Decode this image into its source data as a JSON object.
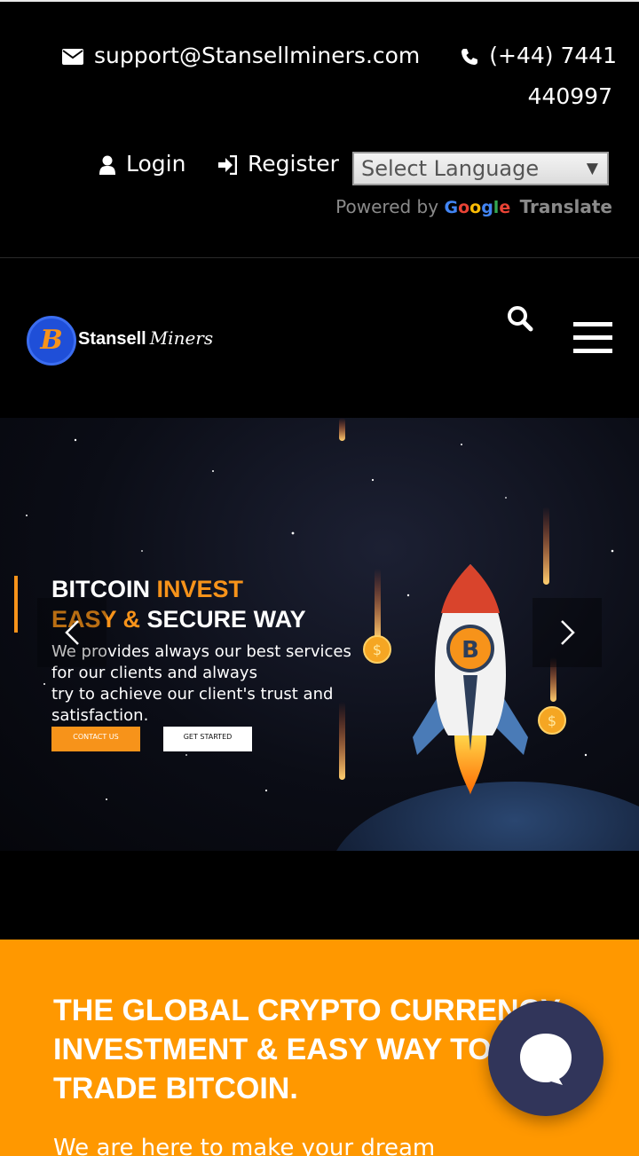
{
  "topbar": {
    "email": "support@Stansellminers.com",
    "phone_line1": "(+44) 7441",
    "phone_line2": "440997",
    "login_label": "Login",
    "register_label": "Register",
    "language_select": "Select Language",
    "powered_by": "Powered by",
    "google": [
      "G",
      "o",
      "o",
      "g",
      "l",
      "e"
    ],
    "translate": "Translate"
  },
  "brand": {
    "coin_symbol": "B",
    "name": "Stansell",
    "name_script": "Miners"
  },
  "hero": {
    "title_part1": "BITCOIN ",
    "title_part2": "INVEST",
    "title_part3": "EASY & ",
    "title_part4": " SECURE WAY",
    "description_line1": "We provides always our best services",
    "description_line2": "for our clients and always",
    "description_line3": "try to achieve our client's trust and",
    "description_line4": "satisfaction.",
    "contact_button": "CONTACT US",
    "start_button": "GET STARTED",
    "rocket_symbol": "B",
    "coin_symbol": "$"
  },
  "about": {
    "headline_line1": "THE GLOBAL CRYPTO CURRENCY",
    "headline_line2": "INVESTMENT & EASY WAY TO",
    "headline_line3": "TRADE BITCOIN.",
    "text": "We are here to make your dream"
  },
  "colors": {
    "accent": "#f7931a",
    "section_orange": "#ff9800",
    "chat_bubble": "#31355a",
    "google_blue": "#4285f4",
    "google_red": "#ea4335",
    "google_yellow": "#fbbc05",
    "google_green": "#34a853"
  },
  "icons": [
    "envelope-icon",
    "phone-icon",
    "user-icon",
    "sign-in-icon",
    "search-icon",
    "hamburger-menu-icon",
    "chevron-left-icon",
    "chevron-right-icon",
    "chat-icon",
    "bitcoin-icon",
    "rocket-icon"
  ]
}
